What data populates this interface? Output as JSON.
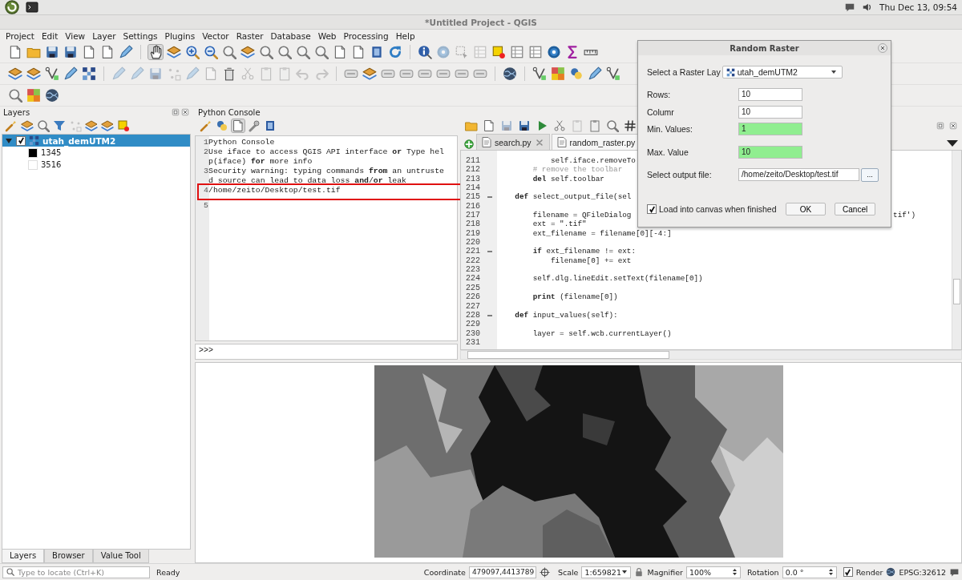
{
  "desktop_bar": {
    "clock": "Thu Dec 13, 09:54"
  },
  "window": {
    "title": "*Untitled Project - QGIS"
  },
  "menu": [
    "Project",
    "Edit",
    "View",
    "Layer",
    "Settings",
    "Plugins",
    "Vector",
    "Raster",
    "Database",
    "Web",
    "Processing",
    "Help"
  ],
  "layers_panel": {
    "title": "Layers",
    "layers": [
      {
        "name": "utah_demUTM2",
        "selected": true,
        "checked": true,
        "expanded": true,
        "legend": [
          {
            "label": "1345",
            "color": "#000000"
          },
          {
            "label": "3516",
            "color": "#ffffff"
          }
        ]
      }
    ],
    "tabs": [
      {
        "label": "Layers",
        "selected": true
      },
      {
        "label": "Browser",
        "selected": false
      },
      {
        "label": "Value Tool",
        "selected": false
      }
    ]
  },
  "python_console": {
    "title": "Python Console",
    "lines": [
      {
        "number": "1",
        "text": "Python Console",
        "boxed": false
      },
      {
        "number": "2",
        "text": "Use iface to access QGIS API interface **or** Type help(iface) **for** more info",
        "boxed": false
      },
      {
        "number": "3",
        "text": "Security warning: typing commands **from** an untrusted source can lead to data loss **and**/**or** leak",
        "boxed": false
      },
      {
        "number": "4",
        "text": "/home/zeito/Desktop/test.tif",
        "boxed": true
      },
      {
        "number": "5",
        "boxed": false
      }
    ],
    "prompt": ">>>"
  },
  "editor": {
    "tabs": [
      {
        "label": "search.py",
        "selected": false,
        "closable": true
      },
      {
        "label": "random_raster.py",
        "selected": true,
        "closable": false
      }
    ],
    "lines": [
      {
        "number": "211",
        "code": "            self.iface.removeTo",
        "kind": "code",
        "fold": false
      },
      {
        "number": "212",
        "code": "        # remove the toolbar",
        "kind": "comment",
        "fold": false
      },
      {
        "number": "213",
        "code": "        **del** self.toolbar",
        "kind": "code",
        "fold": false
      },
      {
        "number": "214",
        "fold": false
      },
      {
        "number": "215",
        "code": "    **def** select_output_file(sel",
        "kind": "code",
        "fold": true
      },
      {
        "number": "216",
        "fold": false
      },
      {
        "number": "217",
        "code": "        filename = QFileDialog",
        "tail": "tif')",
        "kind": "code",
        "fold": false
      },
      {
        "number": "218",
        "code": "        ext = \".tif\"",
        "kind": "code",
        "fold": false
      },
      {
        "number": "219",
        "code": "        ext_filename = filename[0][-4:]",
        "kind": "code",
        "fold": false
      },
      {
        "number": "220",
        "fold": false
      },
      {
        "number": "221",
        "code": "        **if** ext_filename != ext:",
        "kind": "code",
        "fold": true
      },
      {
        "number": "222",
        "code": "            filename[0] += ext",
        "kind": "code",
        "fold": false
      },
      {
        "number": "223",
        "fold": false
      },
      {
        "number": "224",
        "code": "        self.dlg.lineEdit.setText(filename[0])",
        "kind": "code",
        "fold": false
      },
      {
        "number": "225",
        "fold": false
      },
      {
        "number": "226",
        "code": "        **print** (filename[0])",
        "kind": "code",
        "fold": false
      },
      {
        "number": "227",
        "fold": false
      },
      {
        "number": "228",
        "code": "    **def** input_values(self):",
        "kind": "code",
        "fold": true
      },
      {
        "number": "229",
        "fold": false
      },
      {
        "number": "230",
        "code": "        layer = self.wcb.currentLayer()",
        "kind": "code",
        "fold": false
      },
      {
        "number": "231",
        "fold": false
      }
    ]
  },
  "dialog": {
    "title": "Random Raster",
    "fields": [
      {
        "kind": "combo",
        "label": "Select a Raster Lay",
        "value": "utah_demUTM2"
      },
      {
        "kind": "text",
        "label": "Rows:",
        "value": "10",
        "valid": false
      },
      {
        "kind": "text",
        "label": "Columr",
        "value": "10",
        "valid": false
      },
      {
        "kind": "text",
        "label": "Min. Values:",
        "value": "1",
        "valid": true
      },
      {
        "kind": "text",
        "label": "Max. Value",
        "value": "10",
        "valid": true
      },
      {
        "kind": "file",
        "label": "Select output file:",
        "value": "/home/zeito/Desktop/test.tif",
        "button": "..."
      }
    ],
    "load_checkbox": {
      "label": "Load into canvas when finished",
      "checked": true
    },
    "buttons": [
      "OK",
      "Cancel"
    ]
  },
  "status_bar": {
    "locate_placeholder": "Type to locate (Ctrl+K)",
    "message": "Ready",
    "coordinate_label": "Coordinate",
    "coordinate": "479097,4413789",
    "scale_label": "Scale",
    "scale": "1:659821",
    "magnifier_label": "Magnifier",
    "magnifier": "100%",
    "rotation_label": "Rotation",
    "rotation": "0.0 °",
    "render": {
      "label": "Render",
      "checked": true
    },
    "crs": "EPSG:32612"
  }
}
